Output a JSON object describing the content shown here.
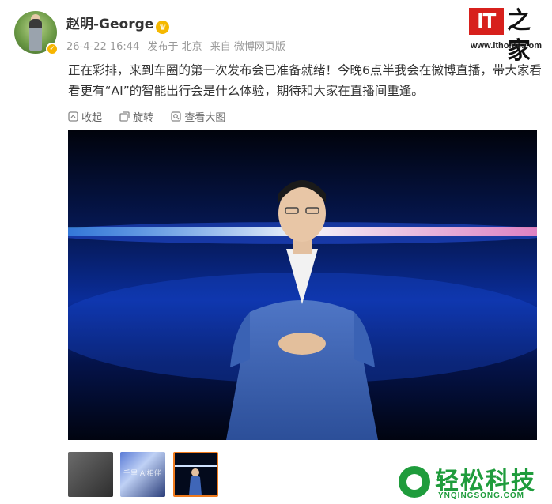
{
  "post": {
    "username": "赵明-George",
    "timestamp": "26-4-22 16:44",
    "location": "发布于 北京",
    "source": "来自 微博网页版",
    "text": "正在彩排，来到车圈的第一次发布会已准备就绪！今晚6点半我会在微博直播，带大家看看更有“AI”的智能出行会是什么体验，期待和大家在直播间重逢。"
  },
  "toolbar": {
    "collapse_label": "收起",
    "rotate_label": "旋转",
    "view_large_label": "查看大图"
  },
  "thumbnails": {
    "t2_label": "千里 AI相伴"
  },
  "watermarks": {
    "ithome_logo": "IT",
    "ithome_chars": "之家",
    "ithome_url": "www.ithome.com",
    "qs_text": "轻松科技",
    "qs_url": "YNQINGSONG.COM"
  },
  "colors": {
    "accent_orange": "#f07b1e",
    "verified_gold": "#f7b500",
    "ithome_red": "#d7201c",
    "qs_green": "#1f9c3c"
  },
  "icons": {
    "collapse": "collapse-icon",
    "rotate": "rotate-icon",
    "view_large": "view-large-icon",
    "crown": "crown-icon",
    "verified": "verified-badge-icon"
  }
}
